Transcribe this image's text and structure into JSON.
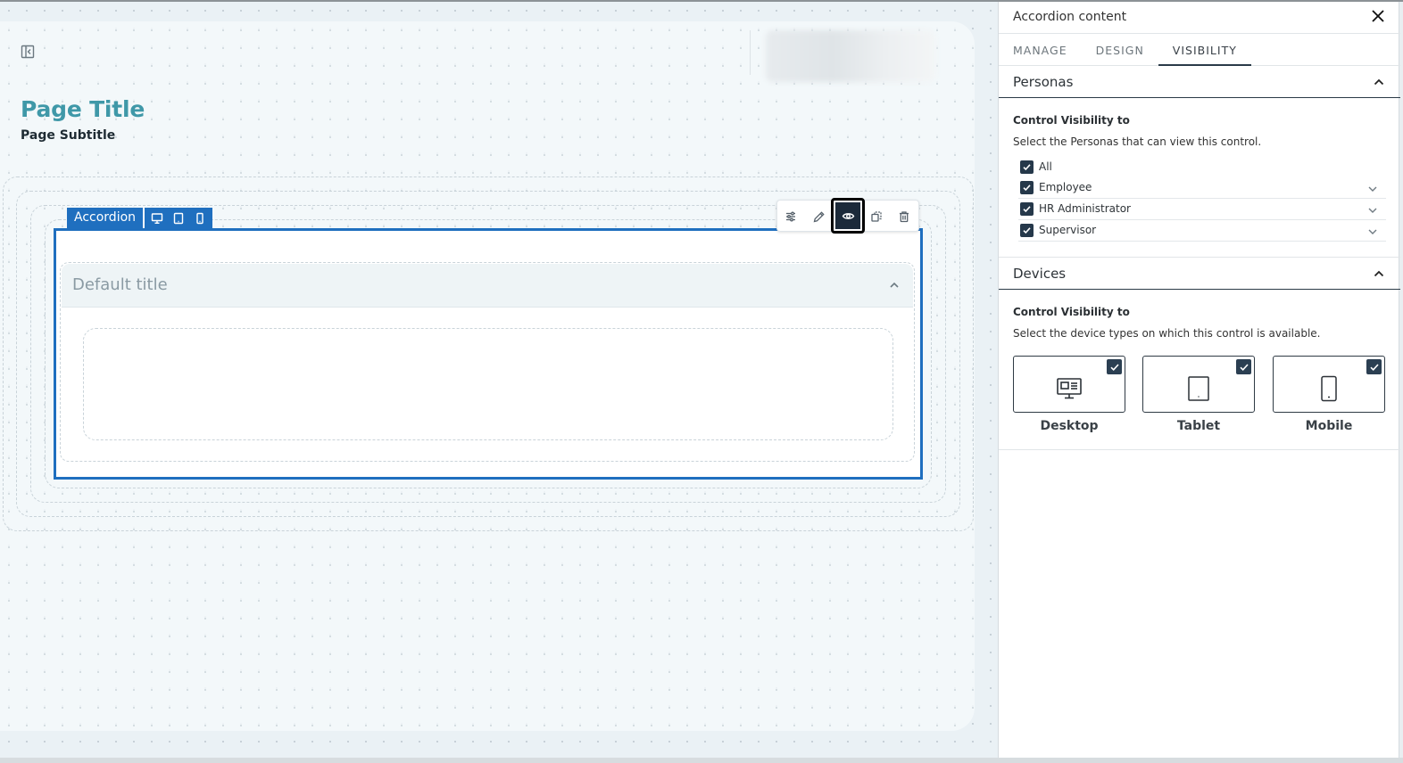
{
  "canvas": {
    "page_title": "Page Title",
    "page_subtitle": "Page Subtitle",
    "accordion_tag": "Accordion",
    "accordion_item_title": "Default title"
  },
  "panel": {
    "title": "Accordion content",
    "tabs": [
      {
        "label": "MANAGE",
        "active": false
      },
      {
        "label": "DESIGN",
        "active": false
      },
      {
        "label": "VISIBILITY",
        "active": true
      }
    ],
    "personas": {
      "header": "Personas",
      "control_title": "Control Visibility to",
      "description": "Select the Personas that can view this control.",
      "items": [
        {
          "label": "All",
          "checked": true
        },
        {
          "label": "Employee",
          "checked": true
        },
        {
          "label": "HR Administrator",
          "checked": true
        },
        {
          "label": "Supervisor",
          "checked": true
        }
      ]
    },
    "devices": {
      "header": "Devices",
      "control_title": "Control Visibility to",
      "description": "Select the device types on which this control is available.",
      "items": [
        {
          "label": "Desktop",
          "checked": true,
          "icon": "desktop-icon"
        },
        {
          "label": "Tablet",
          "checked": true,
          "icon": "tablet-icon"
        },
        {
          "label": "Mobile",
          "checked": true,
          "icon": "mobile-icon"
        }
      ]
    }
  },
  "colors": {
    "accent": "#1f6fbf",
    "title_teal": "#3f98a8",
    "checkbox": "#25384a"
  }
}
